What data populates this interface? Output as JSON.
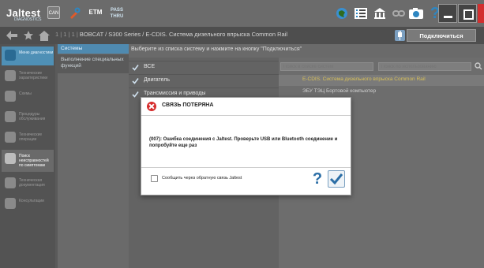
{
  "topbar": {
    "logo": "Jaltest",
    "logo_sub": "DIAGNOSTICS",
    "btn_small": "CAN",
    "etm": "ETM",
    "pass_thru": "PASS\nTHRU"
  },
  "crumbbar": {
    "path_prefix": "1 | 1 | 1 | ",
    "path": "BOBCAT / S300 Series / E-CDIS. Система дизельного впрыска Common Rail",
    "connect_label": "Подключиться"
  },
  "rail": {
    "items": [
      {
        "label": "Меню диагностики"
      },
      {
        "label": "Технические характеристики"
      },
      {
        "label": "Схемы"
      },
      {
        "label": "Процедуры обслуживания"
      },
      {
        "label": "Технические операции"
      },
      {
        "label": "Поиск неисправностей по симптомам"
      },
      {
        "label": "Техническая документация"
      },
      {
        "label": "Консультации"
      }
    ]
  },
  "systems": {
    "header": "Системы",
    "item": "Выполнение специальных функций"
  },
  "main": {
    "instruction": "Выберите из списка систему и нажмите на кнопку \"Подключиться\"",
    "list": [
      {
        "label": "ВСЕ"
      },
      {
        "label": "Двигатель"
      },
      {
        "label": "Трансмиссия и приводы"
      }
    ],
    "search_systems_placeholder": "Поиск в списке систем",
    "search_usage_placeholder": "Поиск по использованию",
    "results": [
      {
        "label": "E-CDIS. Система дизельного впрыска Common Rail"
      },
      {
        "label": "ЭБУ ТЭЦ Бортовой компьютер"
      }
    ]
  },
  "dialog": {
    "title": "СВЯЗЬ ПОТЕРЯНА",
    "message": "(007): Ошибка соединения с Jaltest. Проверьте USB или Bluetooth соединение и попробуйте еще раз",
    "checkbox_label": "Сообщить через обратную связь Jaltest",
    "help_symbol": "?"
  },
  "colors": {
    "accent_blue": "#4f8ab0",
    "error_red": "#d62c2c",
    "result_yellow": "#d8c05a"
  }
}
